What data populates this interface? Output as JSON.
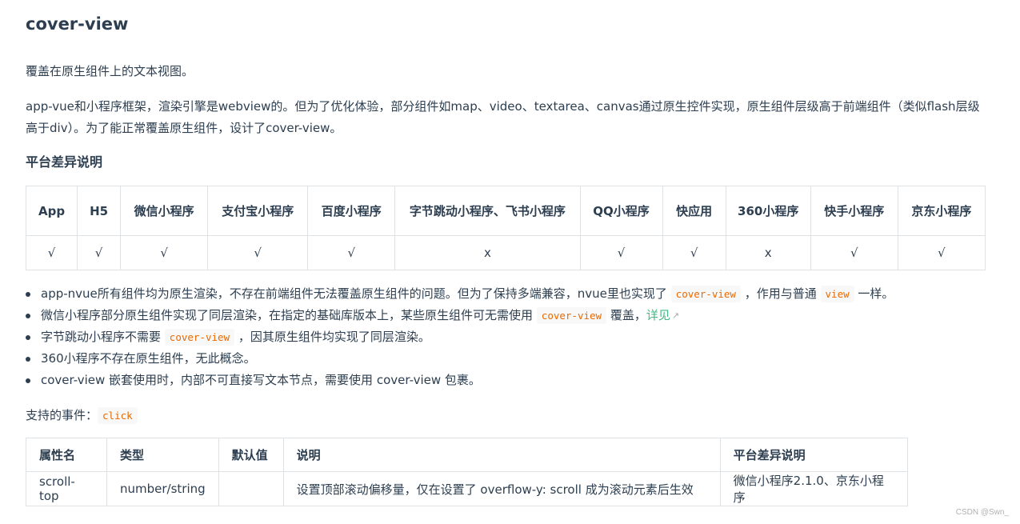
{
  "title": "cover-view",
  "intro": "覆盖在原生组件上的文本视图。",
  "description": "app-vue和小程序框架，渲染引擎是webview的。但为了优化体验，部分组件如map、video、textarea、canvas通过原生控件实现，原生组件层级高于前端组件（类似flash层级高于div）。为了能正常覆盖原生组件，设计了cover-view。",
  "platform_heading": "平台差异说明",
  "platform_table": {
    "headers": [
      "App",
      "H5",
      "微信小程序",
      "支付宝小程序",
      "百度小程序",
      "字节跳动小程序、飞书小程序",
      "QQ小程序",
      "快应用",
      "360小程序",
      "快手小程序",
      "京东小程序"
    ],
    "values": [
      "√",
      "√",
      "√",
      "√",
      "√",
      "x",
      "√",
      "√",
      "x",
      "√",
      "√"
    ]
  },
  "notes": {
    "n1_a": "app-nvue所有组件均为原生渲染，不存在前端组件无法覆盖原生组件的问题。但为了保持多端兼容，nvue里也实现了",
    "n1_code1": "cover-view",
    "n1_b": "，作用与普通",
    "n1_code2": "view",
    "n1_c": "一样。",
    "n2_a": "微信小程序部分原生组件实现了同层渲染，在指定的基础库版本上，某些原生组件可无需使用",
    "n2_code": "cover-view",
    "n2_b": "覆盖，",
    "n2_link": "详见",
    "n3_a": "字节跳动小程序不需要",
    "n3_code": "cover-view",
    "n3_b": "，因其原生组件均实现了同层渲染。",
    "n4": "360小程序不存在原生组件，无此概念。",
    "n5": "cover-view 嵌套使用时，内部不可直接写文本节点，需要使用 cover-view 包裹。"
  },
  "events_label": "支持的事件：",
  "events_code": "click",
  "props_table": {
    "headers": [
      "属性名",
      "类型",
      "默认值",
      "说明",
      "平台差异说明"
    ],
    "rows": [
      [
        "scroll-top",
        "number/string",
        "",
        "设置顶部滚动偏移量，仅在设置了 overflow-y: scroll 成为滚动元素后生效",
        "微信小程序2.1.0、京东小程序"
      ]
    ]
  },
  "watermark": "CSDN @Swn_"
}
